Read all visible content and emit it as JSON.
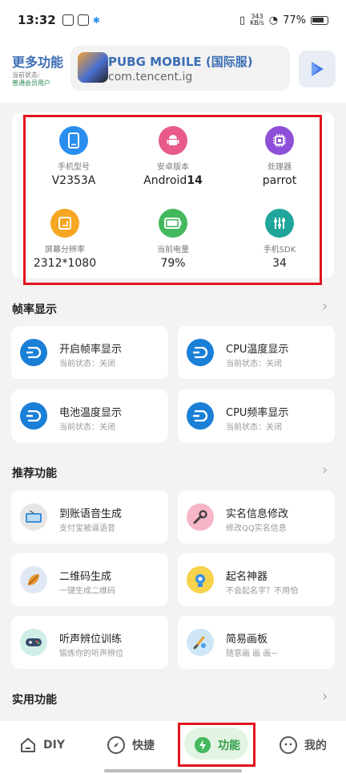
{
  "status_bar": {
    "time": "13:32",
    "net_speed_num": "343",
    "net_speed_unit": "KB/s",
    "battery": "77%"
  },
  "header": {
    "title": "更多功能",
    "status_label": "当前状态:",
    "user_type": "普通会员用户",
    "game_name": "PUBG MOBILE (国际服)",
    "game_package": "com.tencent.ig"
  },
  "device_info": [
    {
      "label": "手机型号",
      "value": "V2353A",
      "icon": "phone-icon",
      "color": "#2a8ef0"
    },
    {
      "label": "安卓版本",
      "value_prefix": "Android",
      "value_bold": "14",
      "icon": "android-icon",
      "color": "#e85a8c"
    },
    {
      "label": "处理器",
      "value": "parrot",
      "icon": "chip-icon",
      "color": "#8e4fd8"
    },
    {
      "label": "屏幕分辨率",
      "value": "2312*1080",
      "icon": "screen-icon",
      "color": "#f6a623"
    },
    {
      "label": "当前电量",
      "value": "79%",
      "icon": "battery-icon",
      "color": "#43b85c"
    },
    {
      "label": "手机SDK",
      "value": "34",
      "icon": "sliders-icon",
      "color": "#1fa59a"
    }
  ],
  "sections": {
    "fps": "帧率显示",
    "recommend": "推荐功能",
    "utility": "实用功能"
  },
  "fps_features": [
    {
      "title": "开启帧率显示",
      "sub": "当前状态：关闭"
    },
    {
      "title": "CPU温度显示",
      "sub": "当前状态：关闭"
    },
    {
      "title": "电池温度显示",
      "sub": "当前状态：关闭"
    },
    {
      "title": "CPU频率显示",
      "sub": "当前状态：关闭"
    }
  ],
  "recommend_features": [
    {
      "title": "到账语音生成",
      "sub": "支付宝被逼语音",
      "icon": "radio-icon"
    },
    {
      "title": "实名信息修改",
      "sub": "修改QQ实名信息",
      "icon": "wrench-icon"
    },
    {
      "title": "二维码生成",
      "sub": "一键生成二维码",
      "icon": "leaf-icon"
    },
    {
      "title": "起名神器",
      "sub": "不会起名字？不用怕",
      "icon": "head-icon"
    },
    {
      "title": "听声辨位训练",
      "sub": "锻炼你的听声辨位",
      "icon": "gamepad-icon"
    },
    {
      "title": "简易画板",
      "sub": "随意画 画 画~",
      "icon": "paint-icon"
    }
  ],
  "nav": [
    {
      "label": "DIY",
      "icon": "home-icon"
    },
    {
      "label": "快捷",
      "icon": "compass-icon"
    },
    {
      "label": "功能",
      "icon": "bolt-icon"
    },
    {
      "label": "我的",
      "icon": "face-icon"
    }
  ]
}
